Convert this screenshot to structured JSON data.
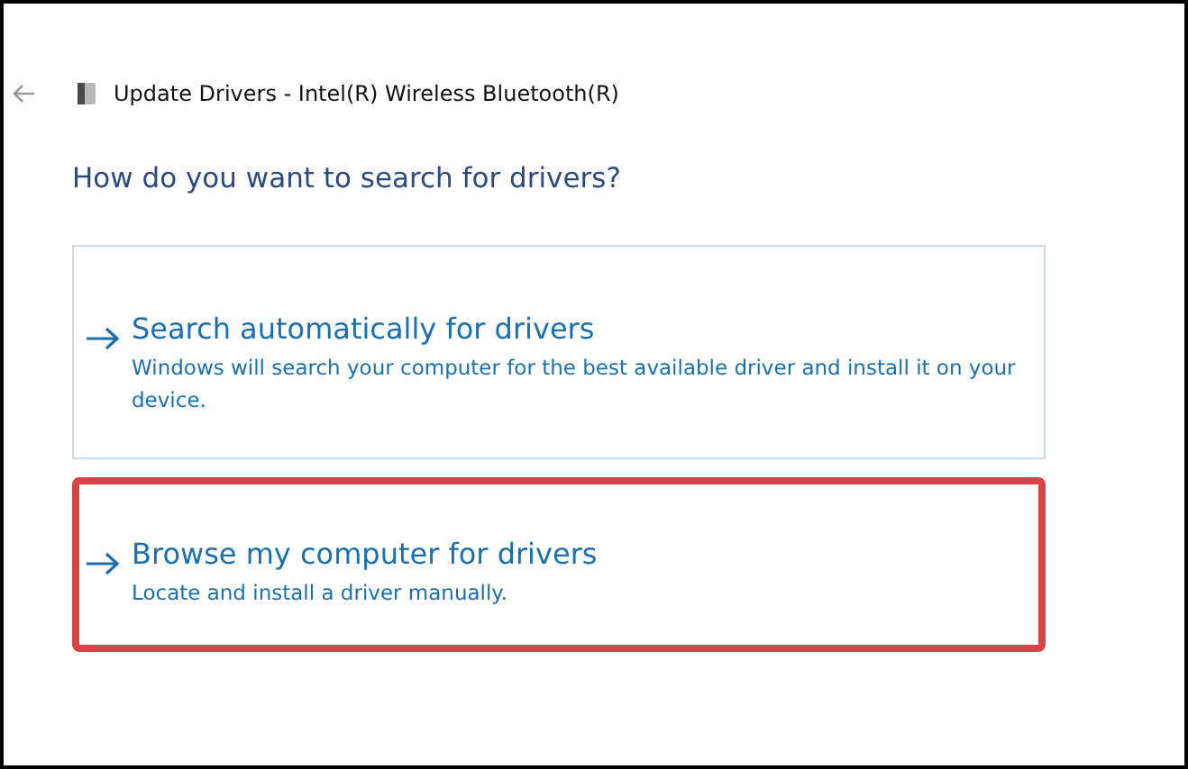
{
  "window": {
    "title": "Update Drivers - Intel(R) Wireless Bluetooth(R)"
  },
  "heading": "How do you want to search for drivers?",
  "options": [
    {
      "title": "Search automatically for drivers",
      "description": "Windows will search your computer for the best available driver and install it on your device.",
      "highlighted": false
    },
    {
      "title": "Browse my computer for drivers",
      "description": "Locate and install a driver manually.",
      "highlighted": true
    }
  ]
}
